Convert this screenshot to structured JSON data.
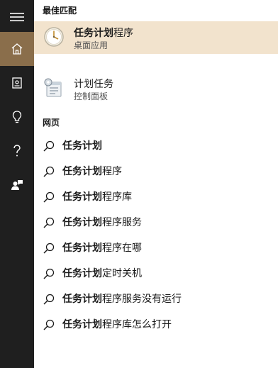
{
  "sidebar": {
    "items": [
      {
        "icon": "hamburger-menu-icon"
      },
      {
        "icon": "home-icon",
        "active": true
      },
      {
        "icon": "notebook-icon"
      },
      {
        "icon": "lightbulb-icon"
      },
      {
        "icon": "question-icon"
      },
      {
        "icon": "feedback-person-icon"
      }
    ],
    "active_color": "#8a6e4b",
    "background": "#1f1f1f"
  },
  "best_match": {
    "heading": "最佳匹配",
    "item": {
      "name_bold": "任务计划",
      "name_rest": "程序",
      "subtitle": "桌面应用",
      "icon": "task-scheduler-clock-icon",
      "highlight_color": "#f2e3cd"
    }
  },
  "settings_result": {
    "name": "计划任务",
    "subtitle": "控制面板",
    "icon": "control-panel-icon"
  },
  "web": {
    "heading": "网页",
    "suggestions": [
      {
        "bold": "任务计划",
        "rest": ""
      },
      {
        "bold": "任务计划",
        "rest": "程序"
      },
      {
        "bold": "任务计划",
        "rest": "程序库"
      },
      {
        "bold": "任务计划",
        "rest": "程序服务"
      },
      {
        "bold": "任务计划",
        "rest": "程序在哪"
      },
      {
        "bold": "任务计划",
        "rest": "定时关机"
      },
      {
        "bold": "任务计划",
        "rest": "程序服务没有运行"
      },
      {
        "bold": "任务计划",
        "rest": "程序库怎么打开"
      }
    ]
  }
}
